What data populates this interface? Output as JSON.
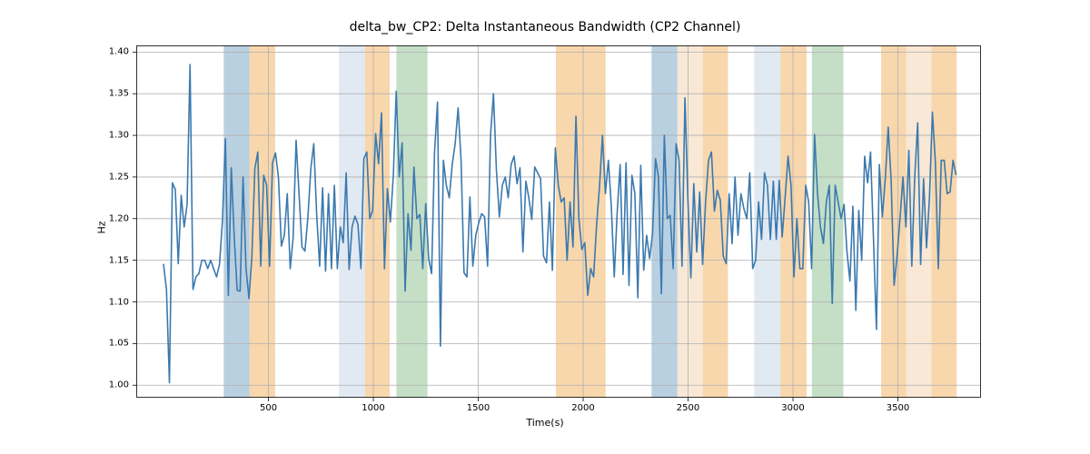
{
  "chart_data": {
    "type": "line",
    "title": "delta_bw_CP2: Delta Instantaneous Bandwidth (CP2 Channel)",
    "xlabel": "Time(s)",
    "ylabel": "Hz",
    "xlim": [
      -130,
      3896
    ],
    "ylim": [
      0.985,
      1.408
    ],
    "xticks": [
      500,
      1000,
      1500,
      2000,
      2500,
      3000,
      3500
    ],
    "yticks": [
      1.0,
      1.05,
      1.1,
      1.15,
      1.2,
      1.25,
      1.3,
      1.35,
      1.4
    ],
    "bands": [
      {
        "x0": 287,
        "x1": 410,
        "color": "#7fa9c9",
        "alpha": 0.55
      },
      {
        "x0": 410,
        "x1": 532,
        "color": "#f2b76a",
        "alpha": 0.55
      },
      {
        "x0": 836,
        "x1": 960,
        "color": "#c8d7ea",
        "alpha": 0.55
      },
      {
        "x0": 960,
        "x1": 1078,
        "color": "#f2b76a",
        "alpha": 0.55
      },
      {
        "x0": 1110,
        "x1": 1258,
        "color": "#93c497",
        "alpha": 0.55
      },
      {
        "x0": 1870,
        "x1": 2107,
        "color": "#f2b76a",
        "alpha": 0.55
      },
      {
        "x0": 2326,
        "x1": 2449,
        "color": "#7fa9c9",
        "alpha": 0.55
      },
      {
        "x0": 2449,
        "x1": 2570,
        "color": "#f2d6b2",
        "alpha": 0.55
      },
      {
        "x0": 2570,
        "x1": 2690,
        "color": "#f2b76a",
        "alpha": 0.55
      },
      {
        "x0": 2815,
        "x1": 2940,
        "color": "#c8d7ea",
        "alpha": 0.55
      },
      {
        "x0": 2940,
        "x1": 3065,
        "color": "#f2b76a",
        "alpha": 0.55
      },
      {
        "x0": 3090,
        "x1": 3240,
        "color": "#93c497",
        "alpha": 0.55
      },
      {
        "x0": 3420,
        "x1": 3540,
        "color": "#f2b76a",
        "alpha": 0.55
      },
      {
        "x0": 3540,
        "x1": 3660,
        "color": "#f2d6b2",
        "alpha": 0.55
      },
      {
        "x0": 3660,
        "x1": 3780,
        "color": "#f2b76a",
        "alpha": 0.55
      }
    ],
    "line_color": "#3b79ae",
    "series": [
      {
        "name": "delta_bw_CP2",
        "x_step": 14.04,
        "x_start": 0,
        "values": [
          1.145,
          1.115,
          1.003,
          1.243,
          1.235,
          1.146,
          1.228,
          1.19,
          1.217,
          1.385,
          1.115,
          1.13,
          1.134,
          1.15,
          1.15,
          1.14,
          1.15,
          1.14,
          1.13,
          1.145,
          1.197,
          1.296,
          1.108,
          1.261,
          1.178,
          1.114,
          1.113,
          1.25,
          1.14,
          1.104,
          1.155,
          1.26,
          1.28,
          1.143,
          1.252,
          1.24,
          1.143,
          1.267,
          1.279,
          1.25,
          1.167,
          1.18,
          1.23,
          1.14,
          1.177,
          1.294,
          1.23,
          1.166,
          1.161,
          1.201,
          1.26,
          1.29,
          1.204,
          1.143,
          1.237,
          1.137,
          1.23,
          1.14,
          1.24,
          1.14,
          1.19,
          1.171,
          1.255,
          1.139,
          1.19,
          1.203,
          1.193,
          1.14,
          1.272,
          1.28,
          1.2,
          1.21,
          1.302,
          1.266,
          1.327,
          1.14,
          1.236,
          1.196,
          1.251,
          1.353,
          1.25,
          1.291,
          1.113,
          1.206,
          1.162,
          1.262,
          1.2,
          1.205,
          1.14,
          1.218,
          1.152,
          1.134,
          1.28,
          1.34,
          1.047,
          1.27,
          1.24,
          1.225,
          1.265,
          1.29,
          1.333,
          1.27,
          1.135,
          1.13,
          1.226,
          1.143,
          1.18,
          1.195,
          1.206,
          1.202,
          1.143,
          1.3,
          1.35,
          1.258,
          1.202,
          1.24,
          1.25,
          1.225,
          1.265,
          1.275,
          1.242,
          1.261,
          1.16,
          1.245,
          1.225,
          1.199,
          1.262,
          1.255,
          1.248,
          1.155,
          1.147,
          1.22,
          1.138,
          1.285,
          1.24,
          1.22,
          1.225,
          1.15,
          1.22,
          1.166,
          1.323,
          1.2,
          1.163,
          1.171,
          1.108,
          1.14,
          1.13,
          1.192,
          1.239,
          1.3,
          1.23,
          1.27,
          1.215,
          1.13,
          1.208,
          1.265,
          1.133,
          1.267,
          1.12,
          1.252,
          1.23,
          1.105,
          1.264,
          1.138,
          1.18,
          1.152,
          1.182,
          1.272,
          1.25,
          1.11,
          1.3,
          1.2,
          1.204,
          1.14,
          1.29,
          1.27,
          1.143,
          1.345,
          1.223,
          1.129,
          1.242,
          1.16,
          1.232,
          1.145,
          1.22,
          1.27,
          1.28,
          1.209,
          1.234,
          1.222,
          1.155,
          1.146,
          1.23,
          1.17,
          1.25,
          1.18,
          1.23,
          1.212,
          1.2,
          1.255,
          1.14,
          1.15,
          1.22,
          1.175,
          1.255,
          1.24,
          1.175,
          1.245,
          1.175,
          1.246,
          1.178,
          1.225,
          1.275,
          1.24,
          1.13,
          1.2,
          1.14,
          1.14,
          1.24,
          1.22,
          1.14,
          1.301,
          1.23,
          1.19,
          1.17,
          1.22,
          1.24,
          1.098,
          1.24,
          1.22,
          1.2,
          1.217,
          1.16,
          1.125,
          1.215,
          1.09,
          1.21,
          1.15,
          1.275,
          1.243,
          1.28,
          1.175,
          1.067,
          1.265,
          1.202,
          1.248,
          1.31,
          1.245,
          1.12,
          1.155,
          1.2,
          1.25,
          1.19,
          1.282,
          1.143,
          1.25,
          1.315,
          1.145,
          1.248,
          1.165,
          1.225,
          1.328,
          1.268,
          1.14,
          1.27,
          1.27,
          1.23,
          1.232,
          1.27,
          1.253
        ]
      }
    ]
  }
}
